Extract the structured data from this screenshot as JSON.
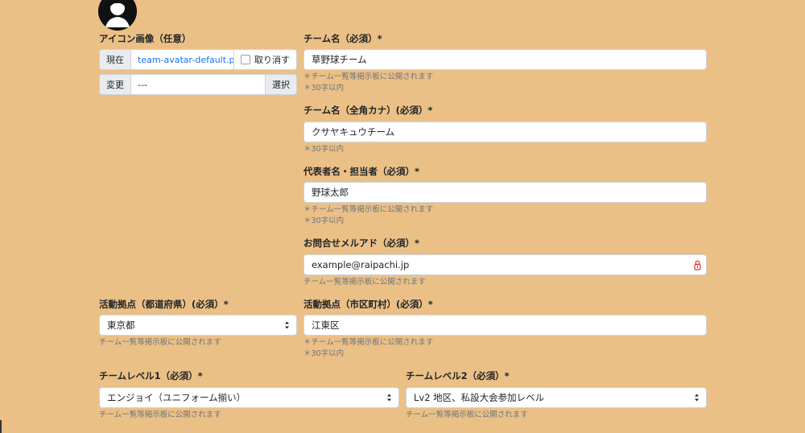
{
  "avatar": {
    "alt": "team avatar"
  },
  "icon_image": {
    "label": "アイコン画像（任意）",
    "current_label": "現在",
    "current_file": "team-avatar-default.png",
    "remove_label": "取り消す",
    "change_label": "変更",
    "change_value": "---",
    "browse_label": "選択"
  },
  "team_name": {
    "label": "チーム名（必須）*",
    "value": "草野球チーム",
    "help": [
      "＊チーム一覧等掲示板に公開されます",
      "＊30字以内"
    ]
  },
  "team_name_kana": {
    "label": "チーム名（全角カナ）(必須）*",
    "value": "クサヤキュウチーム",
    "help": [
      "＊30字以内"
    ]
  },
  "representative": {
    "label": "代表者名・担当者（必須）*",
    "value": "野球太郎",
    "help": [
      "＊チーム一覧等掲示板に公開されます",
      "＊30字以内"
    ]
  },
  "contact_email": {
    "label": "お問合せメルアド（必須）*",
    "value": "example@raipachi.jp",
    "help": [
      "チーム一覧等掲示板に公開されます"
    ]
  },
  "prefecture": {
    "label": "活動拠点（都道府県）(必須）*",
    "value": "東京都",
    "help": [
      "チーム一覧等掲示板に公開されます"
    ]
  },
  "city": {
    "label": "活動拠点（市区町村）(必須）*",
    "value": "江東区",
    "help": [
      "＊チーム一覧等掲示板に公開されます",
      "＊30字以内"
    ]
  },
  "team_level1": {
    "label": "チームレベル1（必須）*",
    "value": "エンジョイ（ユニフォーム揃い）",
    "help": [
      "チーム一覧等掲示板に公開されます"
    ]
  },
  "team_level2": {
    "label": "チームレベル2（必須）*",
    "value": "Lv2 地区、私設大会参加レベル",
    "help": [
      "チーム一覧等掲示板に公開されます"
    ]
  },
  "colors": {
    "background": "#ebc086",
    "link": "#1a73e8",
    "help_text": "#6c757d",
    "password_icon": "#d93025"
  }
}
